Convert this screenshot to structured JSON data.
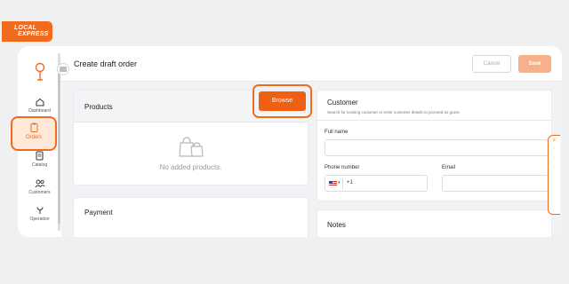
{
  "brand": {
    "line1": "LOCAL",
    "line2": "EXPRESS"
  },
  "sidebar": {
    "items": [
      {
        "label": "Dashboard",
        "icon": "home-icon"
      },
      {
        "label": "Orders",
        "icon": "clipboard-icon"
      },
      {
        "label": "Catalog",
        "icon": "document-icon"
      },
      {
        "label": "Customers",
        "icon": "users-icon"
      },
      {
        "label": "Operation",
        "icon": "wrench-icon"
      }
    ]
  },
  "header": {
    "title": "Create draft order",
    "cancel_label": "Cancel",
    "save_label": "Save"
  },
  "products": {
    "title": "Products",
    "browse_label": "Browse",
    "empty_text": "No added products."
  },
  "payment": {
    "title": "Payment"
  },
  "customer": {
    "title": "Customer",
    "subtitle": "Search for existing customer or enter customer details to proceed as guest",
    "full_name_label": "Full name",
    "phone_label": "Phone number",
    "email_label": "Email",
    "phone_code": "+1"
  },
  "notes": {
    "title": "Notes"
  },
  "colors": {
    "accent": "#f26a1b",
    "save_disabled": "#f8b08a",
    "page_bg": "#eef0f2"
  }
}
